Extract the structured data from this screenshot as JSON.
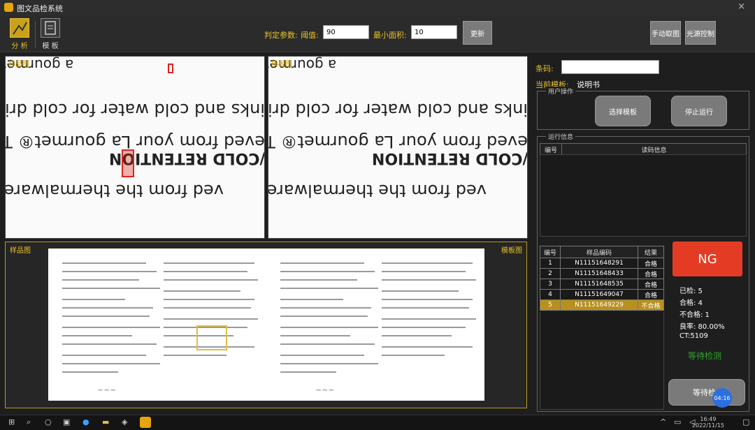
{
  "window": {
    "title": "图文品检系统",
    "close": "×"
  },
  "toolbar": {
    "analyze_label": "分 析",
    "template_label": "模 板",
    "params_label": "判定参数:",
    "threshold_label": "阈值:",
    "threshold_value": "90",
    "minarea_label": "最小面积:",
    "minarea_value": "10",
    "update_button": "更新",
    "manual_capture_button": "手动取图",
    "light_control_button": "光源控制"
  },
  "panels": {
    "sample_label": "样品图",
    "template_label": "模板图",
    "zoom_sample_label": "样品图",
    "zoom_template_label": "模板图"
  },
  "zoom_text": {
    "line1": "ved from the thermalware.",
    "line2": "/COLD RETENTION",
    "line3": "chieved from your La gourmet® Th",
    "line4": "drinks and cold water for cold drink",
    "line5": "a gourmet® The"
  },
  "right": {
    "barcode_label": "条码:",
    "barcode_value": "",
    "current_template_label": "当前模板:",
    "current_template_value": "说明书",
    "user_ops_title": "用户操作",
    "select_template_button": "选择模板",
    "stop_button": "停止运行",
    "run_info_title": "运行信息",
    "info_columns": [
      "编号",
      "读码信息"
    ],
    "results_columns": [
      "编号",
      "样品编码",
      "结果"
    ],
    "results": [
      {
        "no": "1",
        "code": "N11151648291",
        "result": "合格"
      },
      {
        "no": "2",
        "code": "N11151648433",
        "result": "合格"
      },
      {
        "no": "3",
        "code": "N11151648535",
        "result": "合格"
      },
      {
        "no": "4",
        "code": "N11151649047",
        "result": "合格"
      },
      {
        "no": "5",
        "code": "N11151649229",
        "result": "不合格"
      }
    ],
    "ng_label": "NG",
    "checked": "已检:  5",
    "passed": "合格:  4",
    "failed": "不合格:  1",
    "yield": "良率:  80.00%",
    "ct": "CT:5109",
    "status": "等待检测",
    "wait_button": "等待检",
    "badge": "04:16"
  },
  "taskbar": {
    "time": "16:49",
    "date": "2022/11/15"
  },
  "colors": {
    "accent": "#e8c22c",
    "ng": "#e43c24",
    "ok": "#2fa52a"
  }
}
